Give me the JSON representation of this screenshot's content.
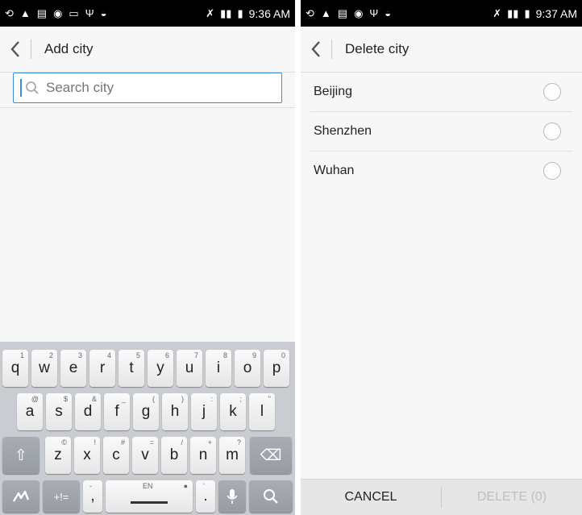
{
  "left": {
    "status": {
      "time": "9:36 AM"
    },
    "title": "Add city",
    "search": {
      "placeholder": "Search city",
      "value": ""
    },
    "keyboard": {
      "row1": [
        {
          "k": "q",
          "h": "1"
        },
        {
          "k": "w",
          "h": "2"
        },
        {
          "k": "e",
          "h": "3"
        },
        {
          "k": "r",
          "h": "4"
        },
        {
          "k": "t",
          "h": "5"
        },
        {
          "k": "y",
          "h": "6"
        },
        {
          "k": "u",
          "h": "7"
        },
        {
          "k": "i",
          "h": "8"
        },
        {
          "k": "o",
          "h": "9"
        },
        {
          "k": "p",
          "h": "0"
        }
      ],
      "row2": [
        {
          "k": "a",
          "h": "@"
        },
        {
          "k": "s",
          "h": "$"
        },
        {
          "k": "d",
          "h": "&"
        },
        {
          "k": "f",
          "h": "_"
        },
        {
          "k": "g",
          "h": "("
        },
        {
          "k": "h",
          "h": ")"
        },
        {
          "k": "j",
          "h": ":"
        },
        {
          "k": "k",
          "h": ";"
        },
        {
          "k": "l",
          "h": "\""
        }
      ],
      "row3": [
        {
          "k": "z",
          "h": "©"
        },
        {
          "k": "x",
          "h": "!"
        },
        {
          "k": "c",
          "h": "#"
        },
        {
          "k": "v",
          "h": "="
        },
        {
          "k": "b",
          "h": "/"
        },
        {
          "k": "n",
          "h": "+"
        },
        {
          "k": "m",
          "h": "?"
        }
      ],
      "symbols_label": "+!=",
      "comma": ",",
      "comma_hint": "-",
      "space_hint": "EN",
      "period": ".",
      "period_hint": "'",
      "shift_glyph": "⇧",
      "backspace_glyph": "⌫"
    }
  },
  "right": {
    "status": {
      "time": "9:37 AM"
    },
    "title": "Delete city",
    "cities": [
      "Beijing",
      "Shenzhen",
      "Wuhan"
    ],
    "cancel_label": "CANCEL",
    "delete_label": "DELETE (0)"
  }
}
